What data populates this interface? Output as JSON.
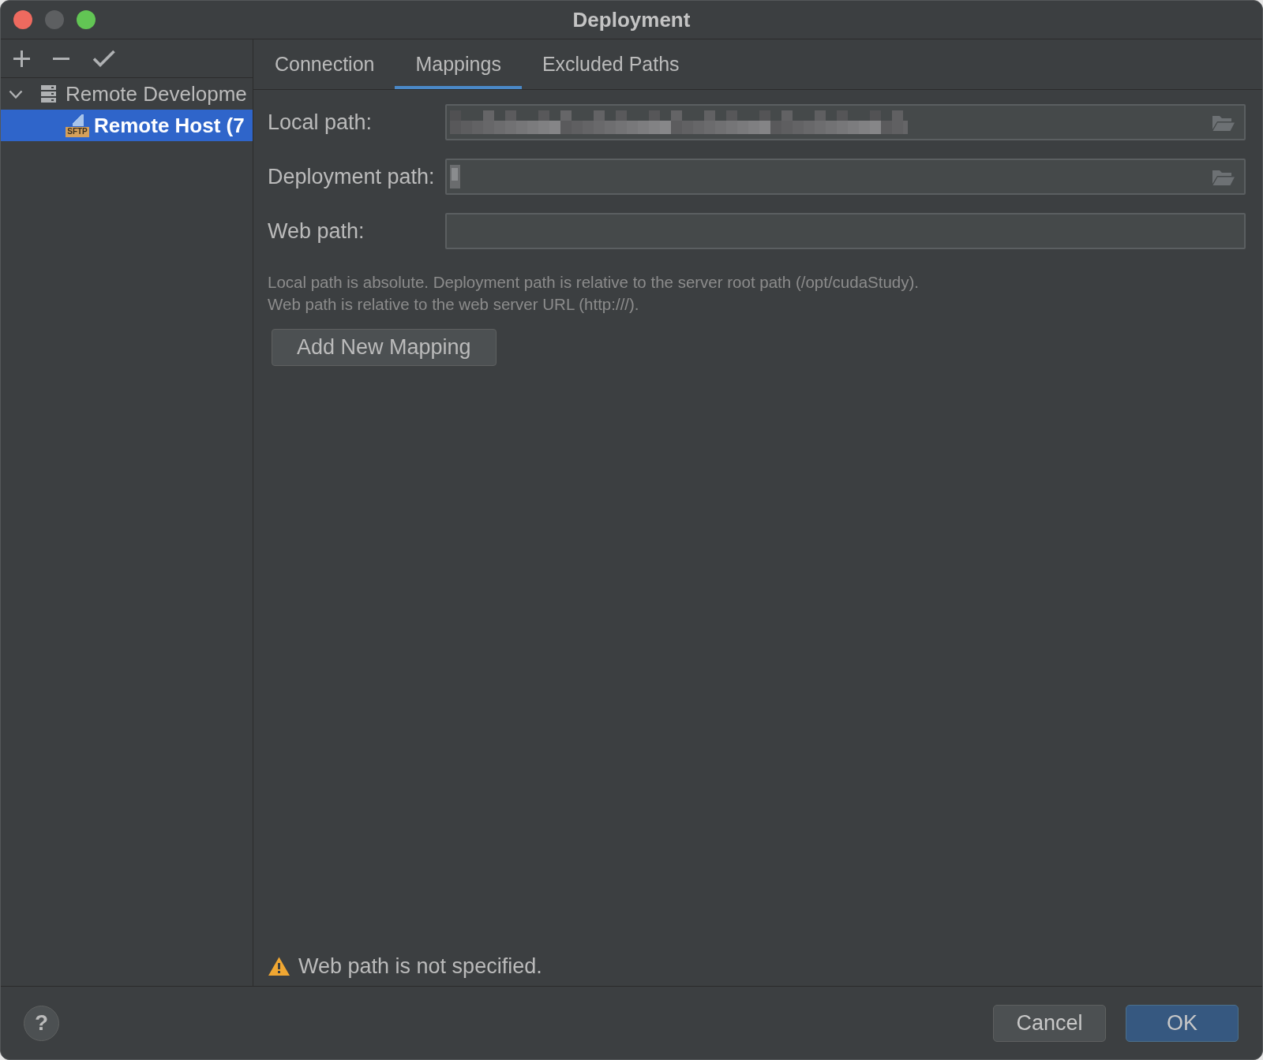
{
  "window": {
    "title": "Deployment",
    "controls": [
      {
        "color": "#ee6a5f"
      },
      {
        "color": "#5d5f61"
      },
      {
        "color": "#62c554"
      }
    ]
  },
  "sidebar": {
    "toolbar": [
      {
        "kind": "add"
      },
      {
        "kind": "remove"
      },
      {
        "kind": "apply"
      }
    ],
    "tree": [
      {
        "label": "Remote Developme",
        "kind": "server-group",
        "expanded": true,
        "selected": false,
        "children": [
          {
            "label": "Remote Host (7",
            "kind": "sftp",
            "badge": "SFTP",
            "selected": true
          }
        ]
      }
    ]
  },
  "tabs": [
    {
      "label": "Connection",
      "selected": false
    },
    {
      "label": "Mappings",
      "selected": true
    },
    {
      "label": "Excluded Paths",
      "selected": false
    }
  ],
  "fields": [
    {
      "label": "Local path:",
      "kind": "longblur",
      "browse": true
    },
    {
      "label": "Deployment path:",
      "kind": "shortblur",
      "browse": true
    },
    {
      "label": "Web path:",
      "kind": "empty",
      "browse": false
    }
  ],
  "hint": [
    "Local path is absolute. Deployment path is relative to the server root path (/opt/cudaStudy).",
    "Web path is relative to the web server URL (http:///)."
  ],
  "add_button": "Add New Mapping",
  "warning": "Web path is not specified.",
  "footer": {
    "help": "?",
    "buttons": [
      {
        "label": "Cancel",
        "kind": "secondary"
      },
      {
        "label": "OK",
        "kind": "primary"
      }
    ]
  }
}
